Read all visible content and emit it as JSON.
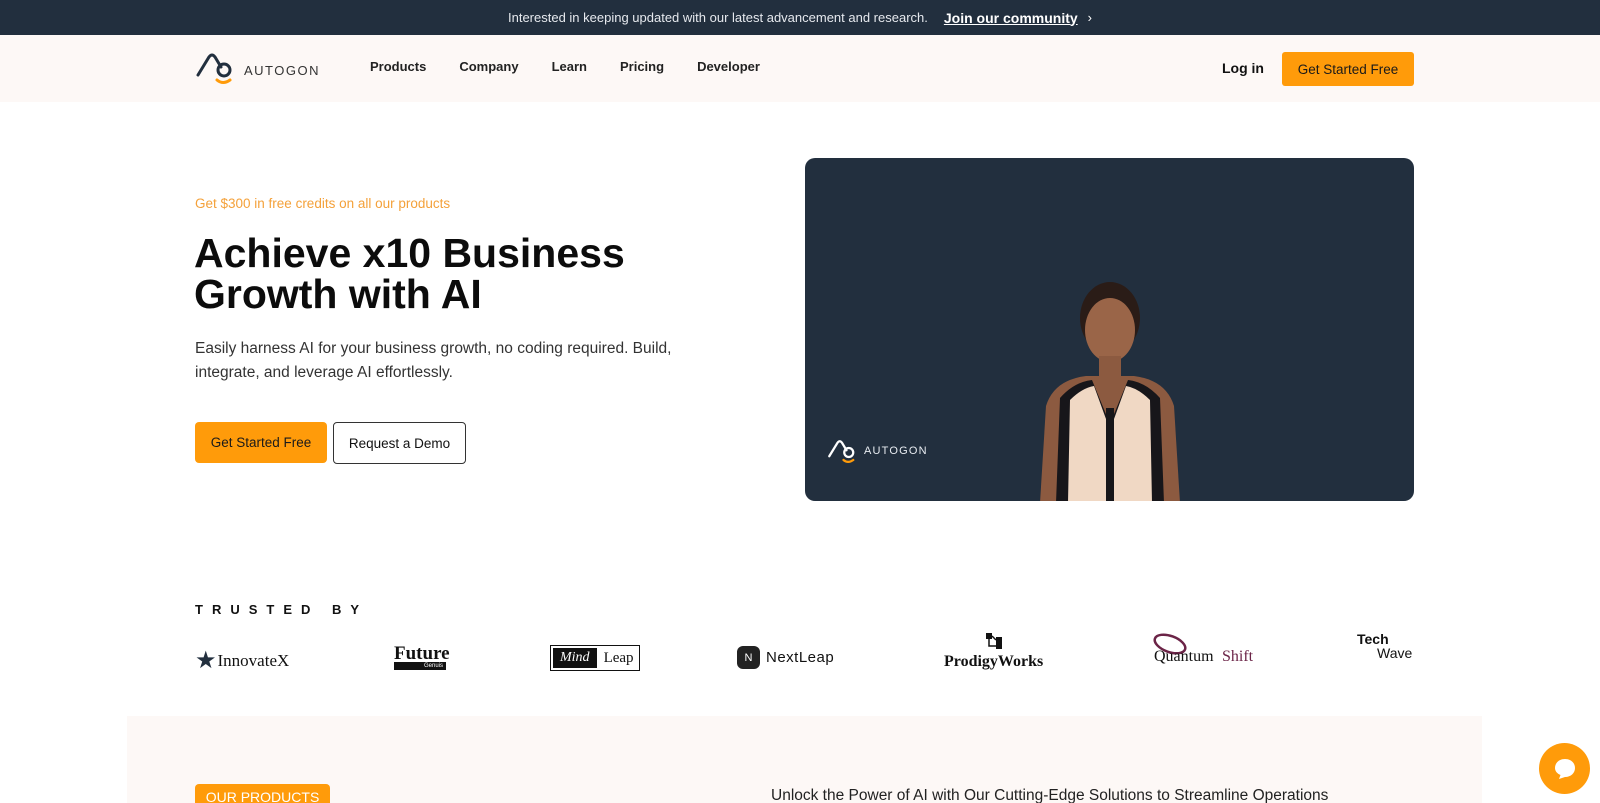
{
  "announcement": {
    "text": "Interested in keeping updated with our latest advancement and research.",
    "link": "Join our community",
    "chevron": "›"
  },
  "nav": {
    "brand": "AUTOGON",
    "menu": [
      "Products",
      "Company",
      "Learn",
      "Pricing",
      "Developer"
    ],
    "login": "Log in",
    "cta": "Get Started Free"
  },
  "hero": {
    "promo": "Get $300 in free credits on all our products",
    "headline": "Achieve x10 Business Growth with AI",
    "subtext": "Easily harness AI for your business growth, no coding required. Build, integrate, and leverage AI effortlessly.",
    "primary_button": "Get Started Free",
    "secondary_button": "Request a Demo"
  },
  "video": {
    "watermark": "AUTOGON"
  },
  "trusted": {
    "heading": "TRUSTED BY",
    "logos": {
      "innovatex": "InnovateX",
      "future": "Future",
      "future_sub": "Genuis",
      "mind": "Mind",
      "leap": "Leap",
      "nextleap": "NextLeap",
      "prodigy": "ProdigyWorks",
      "quantum": "Quantum",
      "shift": "Shift",
      "tech": "Tech",
      "wave": "Wave"
    }
  },
  "products": {
    "tag": "OUR PRODUCTS",
    "line": "Unlock the Power of AI with Our Cutting-Edge Solutions to Streamline Operations"
  },
  "colors": {
    "accent": "#ff9b0a",
    "dark": "#222f3e",
    "cream": "#fdf8f6",
    "promo": "#f4a13a"
  }
}
